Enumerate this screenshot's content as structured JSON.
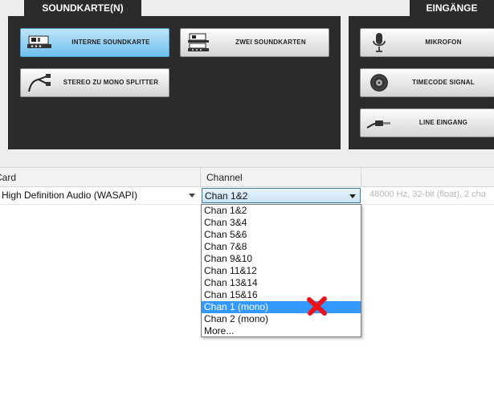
{
  "tabs": {
    "soundkarte": "SOUNDKARTE(N)",
    "eingange": "EINGÄNGE"
  },
  "buttons": {
    "interne": "INTERNE SOUNDKARTE",
    "zwei": "ZWEI SOUNDKARTEN",
    "splitter": "STEREO ZU MONO SPLITTER",
    "mikrofon": "MIKROFON",
    "timecode": "TIMECODE SIGNAL",
    "line": "LINE EINGANG"
  },
  "table": {
    "headers": {
      "card": "Card",
      "channel": "Channel"
    },
    "row": {
      "card": "High Definition Audio (WASAPI)",
      "channel": "Chan 1&2",
      "format": "48000 Hz, 32-bit (float), 2 cha"
    }
  },
  "dropdown": {
    "options": [
      "Chan 1&2",
      "Chan 3&4",
      "Chan 5&6",
      "Chan 7&8",
      "Chan 9&10",
      "Chan 11&12",
      "Chan 13&14",
      "Chan 15&16",
      "Chan 1 (mono)",
      "Chan 2 (mono)",
      "More..."
    ],
    "highlighted_index": 8
  },
  "colors": {
    "panel": "#2b2b2b",
    "active_button": "#6fc0ec",
    "highlight": "#3399ff",
    "annotation": "#e8131b"
  }
}
